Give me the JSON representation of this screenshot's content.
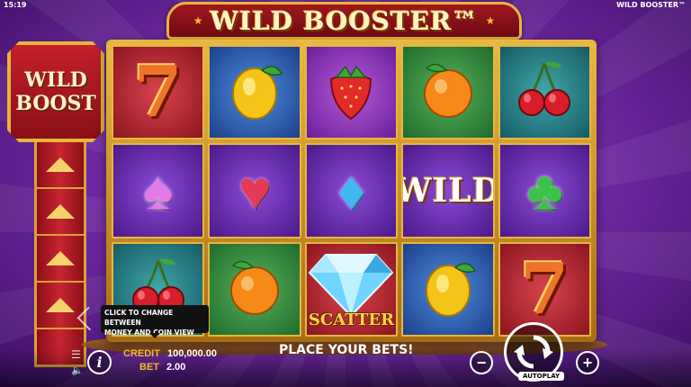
{
  "status_bar": {
    "clock": "15:19",
    "game_name": "WILD BOOSTER™"
  },
  "logo": {
    "title": "WILD BOOSTER™"
  },
  "side_panel": {
    "wild_boost_line1": "WILD",
    "wild_boost_line2": "BOOST",
    "meter_levels": 5
  },
  "reels": {
    "rows": [
      [
        {
          "symbol": "seven",
          "text": "7",
          "bg": "red"
        },
        {
          "symbol": "lemon",
          "bg": "blue"
        },
        {
          "symbol": "strawberry",
          "bg": "purple"
        },
        {
          "symbol": "orange",
          "bg": "green"
        },
        {
          "symbol": "cherries",
          "bg": "teal"
        }
      ],
      [
        {
          "symbol": "spade",
          "bg": "violet"
        },
        {
          "symbol": "heart",
          "bg": "violet"
        },
        {
          "symbol": "diamond",
          "bg": "violet"
        },
        {
          "symbol": "wild",
          "text": "WILD",
          "bg": "violet"
        },
        {
          "symbol": "club",
          "bg": "violet"
        }
      ],
      [
        {
          "symbol": "cherries",
          "bg": "teal"
        },
        {
          "symbol": "orange",
          "bg": "green"
        },
        {
          "symbol": "scatter",
          "text": "SCATTER",
          "bg": "red"
        },
        {
          "symbol": "lemon",
          "bg": "blue"
        },
        {
          "symbol": "seven",
          "text": "7",
          "bg": "red"
        }
      ]
    ]
  },
  "tooltip": {
    "line1": "CLICK TO CHANGE BETWEEN",
    "line2": "MONEY AND COIN VIEW"
  },
  "bottom_bar": {
    "credit_label": "CREDIT",
    "credit_value": "100,000.00",
    "bet_label": "BET",
    "bet_value": "2.00",
    "message": "PLACE YOUR BETS!",
    "minus": "−",
    "plus": "+",
    "autoplay": "AUTOPLAY",
    "info": "i"
  },
  "colors": {
    "frame_gold": "#e8b43a",
    "logo_red": "#a0171f",
    "label_gold": "#f2b933",
    "background_purple": "#7a2fb0"
  }
}
